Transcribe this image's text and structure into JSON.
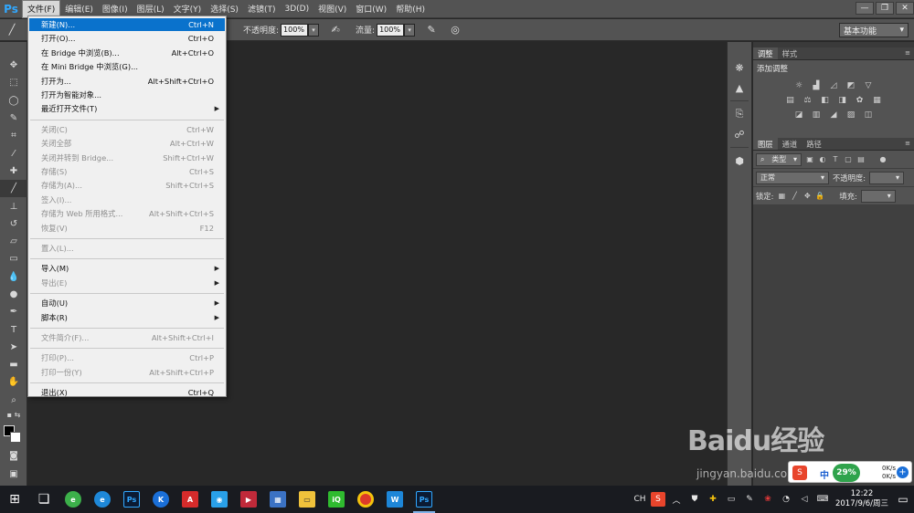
{
  "app": {
    "logo": "Ps"
  },
  "menubar": {
    "items": [
      "文件(F)",
      "编辑(E)",
      "图像(I)",
      "图层(L)",
      "文字(Y)",
      "选择(S)",
      "滤镜(T)",
      "3D(D)",
      "视图(V)",
      "窗口(W)",
      "帮助(H)"
    ],
    "active_index": 0
  },
  "window_controls": {
    "minimize": "—",
    "restore": "❐",
    "close": "✕"
  },
  "options": {
    "opacity_label": "不透明度:",
    "opacity_value": "100%",
    "flow_label": "流量:",
    "flow_value": "100%",
    "workspace": "基本功能"
  },
  "file_menu": {
    "items": [
      {
        "label": "新建(N)...",
        "shortcut": "Ctrl+N",
        "enabled": true,
        "highlighted": true
      },
      {
        "label": "打开(O)...",
        "shortcut": "Ctrl+O",
        "enabled": true
      },
      {
        "label": "在 Bridge 中浏览(B)...",
        "shortcut": "Alt+Ctrl+O",
        "enabled": true
      },
      {
        "label": "在 Mini Bridge 中浏览(G)...",
        "shortcut": "",
        "enabled": true
      },
      {
        "label": "打开为...",
        "shortcut": "Alt+Shift+Ctrl+O",
        "enabled": true
      },
      {
        "label": "打开为智能对象...",
        "shortcut": "",
        "enabled": true
      },
      {
        "label": "最近打开文件(T)",
        "shortcut": "",
        "enabled": true,
        "submenu": true
      },
      {
        "label": "关闭(C)",
        "shortcut": "Ctrl+W",
        "enabled": false
      },
      {
        "label": "关闭全部",
        "shortcut": "Alt+Ctrl+W",
        "enabled": false
      },
      {
        "label": "关闭并转到 Bridge...",
        "shortcut": "Shift+Ctrl+W",
        "enabled": false
      },
      {
        "label": "存储(S)",
        "shortcut": "Ctrl+S",
        "enabled": false
      },
      {
        "label": "存储为(A)...",
        "shortcut": "Shift+Ctrl+S",
        "enabled": false
      },
      {
        "label": "签入(I)...",
        "shortcut": "",
        "enabled": false
      },
      {
        "label": "存储为 Web 所用格式...",
        "shortcut": "Alt+Shift+Ctrl+S",
        "enabled": false
      },
      {
        "label": "恢复(V)",
        "shortcut": "F12",
        "enabled": false
      },
      {
        "label": "置入(L)...",
        "shortcut": "",
        "enabled": false
      },
      {
        "label": "导入(M)",
        "shortcut": "",
        "enabled": true,
        "submenu": true
      },
      {
        "label": "导出(E)",
        "shortcut": "",
        "enabled": false,
        "submenu": true
      },
      {
        "label": "自动(U)",
        "shortcut": "",
        "enabled": true,
        "submenu": true
      },
      {
        "label": "脚本(R)",
        "shortcut": "",
        "enabled": true,
        "submenu": true
      },
      {
        "label": "文件简介(F)...",
        "shortcut": "Alt+Shift+Ctrl+I",
        "enabled": false
      },
      {
        "label": "打印(P)...",
        "shortcut": "Ctrl+P",
        "enabled": false
      },
      {
        "label": "打印一份(Y)",
        "shortcut": "Alt+Shift+Ctrl+P",
        "enabled": false
      },
      {
        "label": "退出(X)",
        "shortcut": "Ctrl+Q",
        "enabled": true
      }
    ]
  },
  "adjust_panel": {
    "tabs": [
      "调整",
      "样式"
    ],
    "title": "添加调整"
  },
  "layers_panel": {
    "tabs": [
      "图层",
      "通道",
      "路径"
    ],
    "filter": "类型",
    "blend_mode": "正常",
    "opacity_label": "不透明度:",
    "lock_label": "锁定:",
    "fill_label": "填充:"
  },
  "watermark": {
    "main": "Baidu经验",
    "sub": "jingyan.baidu.com"
  },
  "net_widget": {
    "ime": "中",
    "percent": "29%",
    "up": "0K/s",
    "down": "0K/s",
    "add": "+"
  },
  "taskbar": {
    "tray_lang": "CH",
    "time": "12:22",
    "date": "2017/9/6/周三"
  }
}
